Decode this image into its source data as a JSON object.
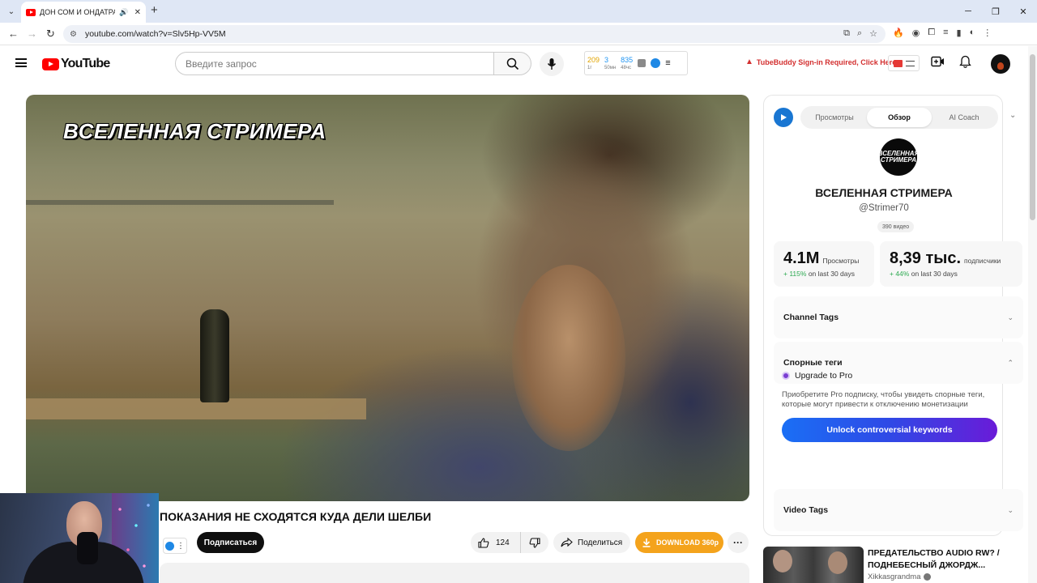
{
  "browser": {
    "tab_title": "ДОН СОМ И ОНДАТРА - ПОКАЗАНИЯ НЕ СХОДЯТСЯ",
    "url": "youtube.com/watch?v=Slv5Hp-VV5M"
  },
  "masthead": {
    "logo_text": "YouTube",
    "search_placeholder": "Введите запрос",
    "stats": [
      {
        "value": "209",
        "sub": "1г",
        "color": "#e2a400"
      },
      {
        "value": "3",
        "sub": "50мн",
        "color": "#2296f3"
      },
      {
        "value": "835",
        "sub": "48чс",
        "color": "#2296f3"
      }
    ],
    "tubebuddy_warning": "TubeBuddy Sign-in Required, Click Here"
  },
  "video": {
    "watermark": "ВСЕЛЕННАЯ СТРИМЕРА",
    "title": "ПОКАЗАНИЯ НЕ СХОДЯТСЯ КУДА ДЕЛИ ШЕЛБИ",
    "subscribe_label": "Подписаться",
    "like_count": "124",
    "share_label": "Поделиться",
    "download_label": "DOWNLOAD 360p",
    "download_color": "#f4a31c"
  },
  "panel": {
    "tabs": [
      {
        "label": "Просмотры",
        "active": false
      },
      {
        "label": "Обзор",
        "active": true
      },
      {
        "label": "AI Coach",
        "active": false
      }
    ],
    "channel_logo_text": "ВСЕЛЕННАЯ СТРИМЕРА",
    "channel_name": "ВСЕЛЕННАЯ СТРИМЕРА",
    "channel_handle": "@Strimer70",
    "video_count": "390 видео",
    "views": {
      "value": "4.1M",
      "label": "Просмотры",
      "change": "+ 115%",
      "period": "on last 30 days"
    },
    "subscribers": {
      "value": "8,39 тыс.",
      "label": "подписчики",
      "change": "+ 44%",
      "period": "on last 30 days"
    },
    "sections": {
      "channel_tags": "Channel Tags",
      "controversial_tags": "Спорные теги",
      "video_tags": "Video Tags"
    },
    "upgrade_title": "Upgrade to Pro",
    "upgrade_text": "Приобретите Pro подписку, чтобы увидеть спорные теги, которые могут привести к отключению монетизации",
    "unlock_button": "Unlock controversial keywords"
  },
  "recommended": {
    "title": "ПРЕДАТЕЛЬСТВО AUDIO RW? / ПОДНЕБЕСНЫЙ ДЖОРДЖ...",
    "author": "Xikkasgrandma"
  },
  "colors": {
    "accent_red": "#ff0000",
    "growth_green": "#2eaa52",
    "unlock_gradient_start": "#1a6ff5",
    "unlock_gradient_end": "#6a1bd8"
  }
}
